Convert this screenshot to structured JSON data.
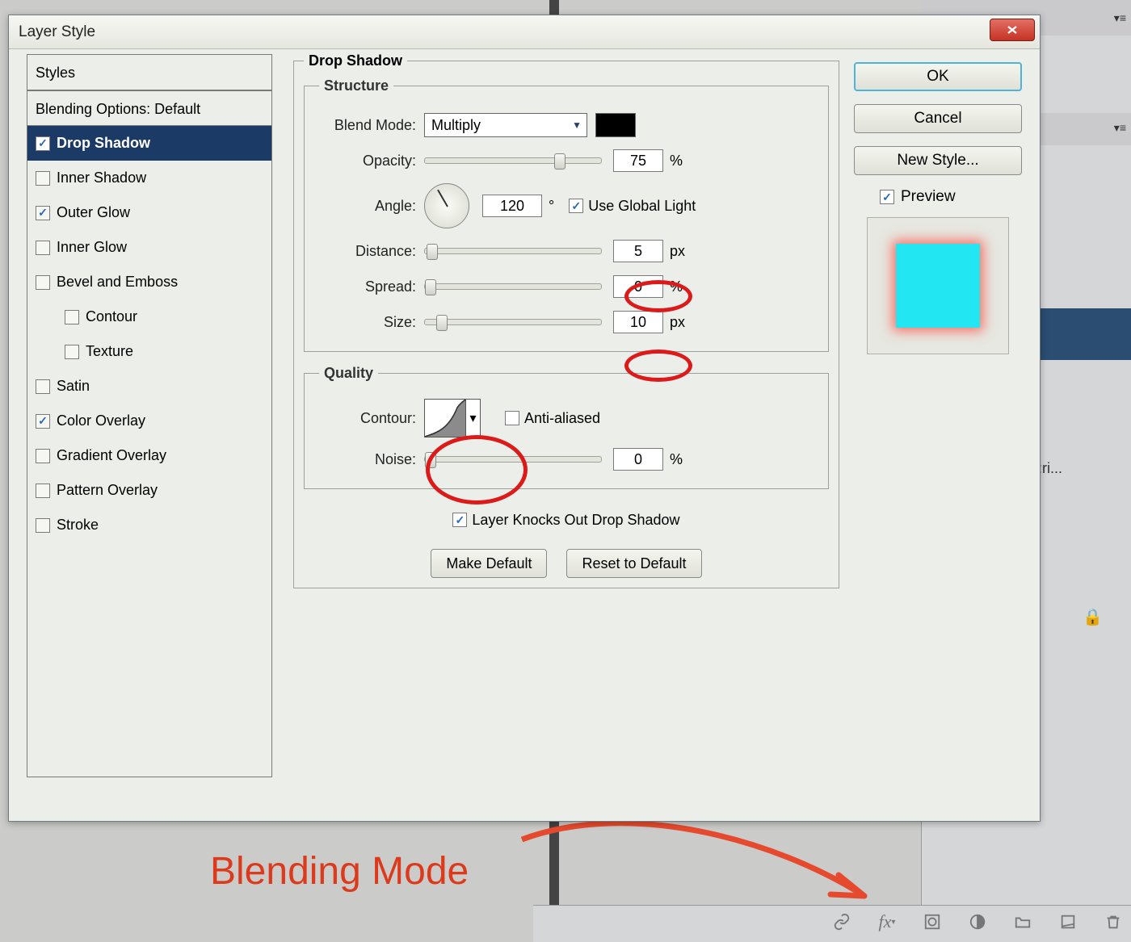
{
  "dialog": {
    "title": "Layer Style",
    "styles_header": "Styles",
    "blending_options": "Blending Options: Default",
    "items": [
      {
        "label": "Drop Shadow",
        "checked": true,
        "selected": true
      },
      {
        "label": "Inner Shadow",
        "checked": false
      },
      {
        "label": "Outer Glow",
        "checked": true
      },
      {
        "label": "Inner Glow",
        "checked": false
      },
      {
        "label": "Bevel and Emboss",
        "checked": false
      },
      {
        "label": "Contour",
        "checked": false,
        "sub": true
      },
      {
        "label": "Texture",
        "checked": false,
        "sub": true
      },
      {
        "label": "Satin",
        "checked": false
      },
      {
        "label": "Color Overlay",
        "checked": true
      },
      {
        "label": "Gradient Overlay",
        "checked": false
      },
      {
        "label": "Pattern Overlay",
        "checked": false
      },
      {
        "label": "Stroke",
        "checked": false
      }
    ],
    "panel_title": "Drop Shadow",
    "structure": {
      "legend": "Structure",
      "blend_mode_label": "Blend Mode:",
      "blend_mode_value": "Multiply",
      "opacity_label": "Opacity:",
      "opacity_value": "75",
      "opacity_unit": "%",
      "angle_label": "Angle:",
      "angle_value": "120",
      "angle_unit": "°",
      "use_global_light": "Use Global Light",
      "distance_label": "Distance:",
      "distance_value": "5",
      "distance_unit": "px",
      "spread_label": "Spread:",
      "spread_value": "0",
      "spread_unit": "%",
      "size_label": "Size:",
      "size_value": "10",
      "size_unit": "px"
    },
    "quality": {
      "legend": "Quality",
      "contour_label": "Contour:",
      "anti_aliased": "Anti-aliased",
      "noise_label": "Noise:",
      "noise_value": "0",
      "noise_unit": "%"
    },
    "knockout_label": "Layer Knocks Out Drop Shadow",
    "make_default": "Make Default",
    "reset_default": "Reset to Default",
    "ok": "OK",
    "cancel": "Cancel",
    "new_style": "New Style...",
    "preview": "Preview"
  },
  "side_panel": {
    "layer_text": "oat:ri..."
  },
  "annotation_text": "Blending Mode"
}
